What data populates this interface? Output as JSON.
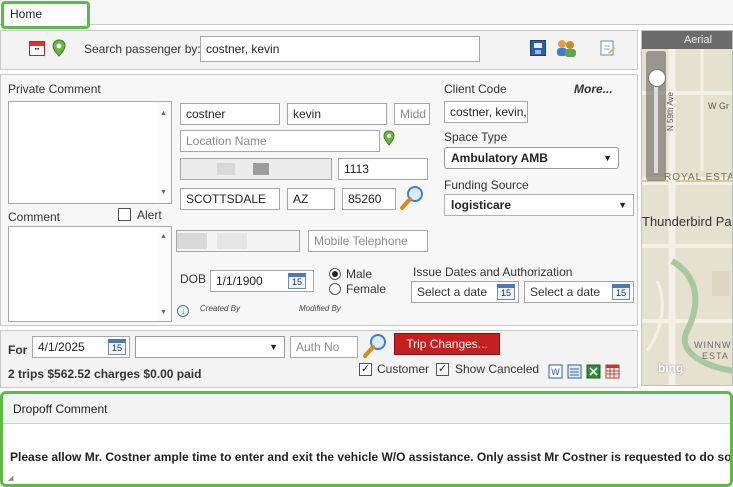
{
  "tab": {
    "label": "Home"
  },
  "search": {
    "label": "Search passenger by:",
    "value": "costner, kevin"
  },
  "private_comment": {
    "label": "Private Comment"
  },
  "comment": {
    "label": "Comment"
  },
  "alert": {
    "label": "Alert",
    "checked": false
  },
  "passenger": {
    "last_name": "costner",
    "first_name": "kevin",
    "middle_placeholder": "Midd",
    "location_placeholder": "Location Name",
    "address_number": "1113",
    "city": "SCOTTSDALE",
    "state": "AZ",
    "zip": "85260",
    "mobile_placeholder": "Mobile Telephone",
    "dob_label": "DOB",
    "dob": "1/1/1900",
    "gender_options": [
      "Male",
      "Female"
    ],
    "gender_selected": "Male",
    "created_by_label": "Created By",
    "modified_by_label": "Modified By"
  },
  "client": {
    "code_label": "Client Code",
    "more_label": "More...",
    "code_value": "costner, kevin,",
    "space_type_label": "Space Type",
    "space_type_value": "Ambulatory AMB",
    "funding_label": "Funding Source",
    "funding_value": "logisticare",
    "issue_label": "Issue Dates and Authorization",
    "select_date_1": "Select a date",
    "select_date_2": "Select a date"
  },
  "map": {
    "mode": "Aerial",
    "labels": [
      "Thunderbird Pa",
      "ROYAL ESTA",
      "N 59th Ave",
      "W Gr",
      "WINNW",
      "ESTA"
    ],
    "attribution": "bing"
  },
  "trip": {
    "for_label": "For",
    "date": "4/1/2025",
    "auth_placeholder": "Auth No",
    "changes_button": "Trip Changes...",
    "summary": "2 trips $562.52 charges $0.00 paid",
    "customer_label": "Customer",
    "customer_checked": true,
    "show_canceled_label": "Show Canceled",
    "show_canceled_checked": true
  },
  "dropoff": {
    "header": "Dropoff Comment",
    "text": "Please allow Mr. Costner ample time to enter and exit the vehicle W/O assistance.  Only assist Mr Costner is requested to do so."
  },
  "colors": {
    "highlight": "#5dbb45",
    "trip_changes_bg": "#c51f1f",
    "map_bg": "#e8e3d3"
  },
  "calendar_icon_text": "15"
}
